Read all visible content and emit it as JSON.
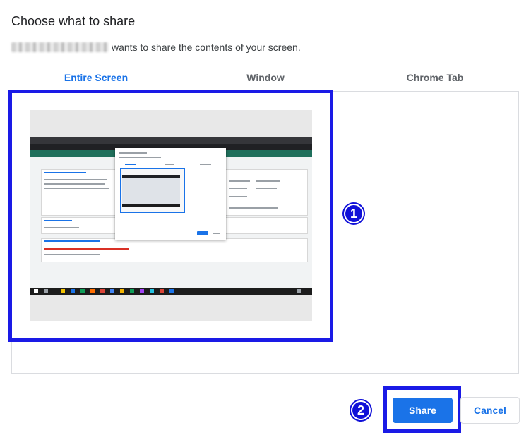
{
  "dialog": {
    "title": "Choose what to share",
    "subtitle_suffix": "wants to share the contents of your screen."
  },
  "tabs": [
    {
      "label": "Entire Screen",
      "active": true
    },
    {
      "label": "Window",
      "active": false
    },
    {
      "label": "Chrome Tab",
      "active": false
    }
  ],
  "annotations": {
    "step1": "1",
    "step2": "2",
    "highlight_color": "#1a1ae6"
  },
  "buttons": {
    "share": "Share",
    "cancel": "Cancel"
  },
  "colors": {
    "accent": "#1a73e8",
    "tab_inactive": "#5f6368"
  }
}
